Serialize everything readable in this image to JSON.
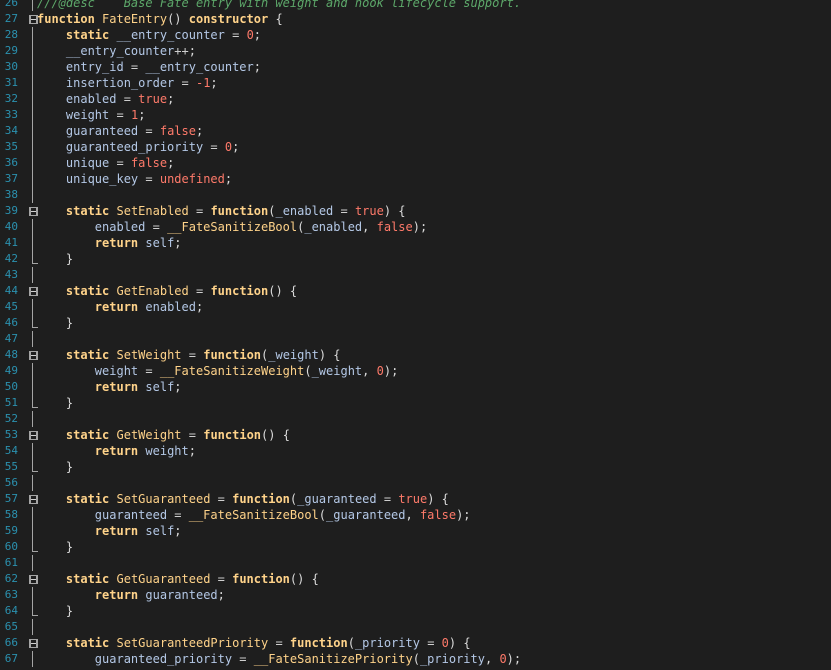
{
  "colors": {
    "background": "#1e1e1e",
    "line_number": "#2b91af",
    "keyword": "#ffd38a",
    "variable": "#b4c8e6",
    "number": "#ff7a6a",
    "comment": "#5da86a"
  },
  "lines": [
    {
      "num": "26",
      "fold": "line",
      "tokens": [
        [
          "cm",
          "///@desc    Base Fate entry with weight and hook lifecycle support."
        ]
      ]
    },
    {
      "num": "27",
      "fold": "box",
      "tokens": [
        [
          "kw",
          "function"
        ],
        [
          "pl",
          " "
        ],
        [
          "fn",
          "FateEntry"
        ],
        [
          "p",
          "() "
        ],
        [
          "kw",
          "constructor"
        ],
        [
          "p",
          " {"
        ]
      ]
    },
    {
      "num": "28",
      "fold": "line",
      "tokens": [
        [
          "pl",
          "    "
        ],
        [
          "kw",
          "static"
        ],
        [
          "pl",
          " "
        ],
        [
          "var",
          "__entry_counter"
        ],
        [
          "op",
          " = "
        ],
        [
          "num",
          "0"
        ],
        [
          "p",
          ";"
        ]
      ]
    },
    {
      "num": "29",
      "fold": "line",
      "tokens": [
        [
          "pl",
          "    "
        ],
        [
          "var",
          "__entry_counter"
        ],
        [
          "op",
          "++"
        ],
        [
          "p",
          ";"
        ]
      ]
    },
    {
      "num": "30",
      "fold": "line",
      "tokens": [
        [
          "pl",
          "    "
        ],
        [
          "var",
          "entry_id"
        ],
        [
          "op",
          " = "
        ],
        [
          "var",
          "__entry_counter"
        ],
        [
          "p",
          ";"
        ]
      ]
    },
    {
      "num": "31",
      "fold": "line",
      "tokens": [
        [
          "pl",
          "    "
        ],
        [
          "var",
          "insertion_order"
        ],
        [
          "op",
          " = "
        ],
        [
          "num",
          "-1"
        ],
        [
          "p",
          ";"
        ]
      ]
    },
    {
      "num": "32",
      "fold": "line",
      "tokens": [
        [
          "pl",
          "    "
        ],
        [
          "var",
          "enabled"
        ],
        [
          "op",
          " = "
        ],
        [
          "bool",
          "true"
        ],
        [
          "p",
          ";"
        ]
      ]
    },
    {
      "num": "33",
      "fold": "line",
      "tokens": [
        [
          "pl",
          "    "
        ],
        [
          "var",
          "weight"
        ],
        [
          "op",
          " = "
        ],
        [
          "num",
          "1"
        ],
        [
          "p",
          ";"
        ]
      ]
    },
    {
      "num": "34",
      "fold": "line",
      "tokens": [
        [
          "pl",
          "    "
        ],
        [
          "var",
          "guaranteed"
        ],
        [
          "op",
          " = "
        ],
        [
          "bool",
          "false"
        ],
        [
          "p",
          ";"
        ]
      ]
    },
    {
      "num": "35",
      "fold": "line",
      "tokens": [
        [
          "pl",
          "    "
        ],
        [
          "var",
          "guaranteed_priority"
        ],
        [
          "op",
          " = "
        ],
        [
          "num",
          "0"
        ],
        [
          "p",
          ";"
        ]
      ]
    },
    {
      "num": "36",
      "fold": "line",
      "tokens": [
        [
          "pl",
          "    "
        ],
        [
          "var",
          "unique"
        ],
        [
          "op",
          " = "
        ],
        [
          "bool",
          "false"
        ],
        [
          "p",
          ";"
        ]
      ]
    },
    {
      "num": "37",
      "fold": "line",
      "tokens": [
        [
          "pl",
          "    "
        ],
        [
          "var",
          "unique_key"
        ],
        [
          "op",
          " = "
        ],
        [
          "bool",
          "undefined"
        ],
        [
          "p",
          ";"
        ]
      ]
    },
    {
      "num": "38",
      "fold": "line",
      "tokens": []
    },
    {
      "num": "39",
      "fold": "box",
      "tokens": [
        [
          "pl",
          "    "
        ],
        [
          "kw",
          "static"
        ],
        [
          "pl",
          " "
        ],
        [
          "fn",
          "SetEnabled"
        ],
        [
          "op",
          " = "
        ],
        [
          "kw",
          "function"
        ],
        [
          "p",
          "("
        ],
        [
          "var",
          "_enabled"
        ],
        [
          "op",
          " = "
        ],
        [
          "bool",
          "true"
        ],
        [
          "p",
          ") {"
        ]
      ]
    },
    {
      "num": "40",
      "fold": "line",
      "tokens": [
        [
          "pl",
          "        "
        ],
        [
          "var",
          "enabled"
        ],
        [
          "op",
          " = "
        ],
        [
          "fn",
          "__FateSanitizeBool"
        ],
        [
          "p",
          "("
        ],
        [
          "var",
          "_enabled"
        ],
        [
          "p",
          ", "
        ],
        [
          "bool",
          "false"
        ],
        [
          "p",
          ");"
        ]
      ]
    },
    {
      "num": "41",
      "fold": "line",
      "tokens": [
        [
          "pl",
          "        "
        ],
        [
          "kw",
          "return"
        ],
        [
          "pl",
          " "
        ],
        [
          "var",
          "self"
        ],
        [
          "p",
          ";"
        ]
      ]
    },
    {
      "num": "42",
      "fold": "end",
      "tokens": [
        [
          "pl",
          "    "
        ],
        [
          "p",
          "}"
        ]
      ]
    },
    {
      "num": "43",
      "fold": "line",
      "tokens": []
    },
    {
      "num": "44",
      "fold": "box",
      "tokens": [
        [
          "pl",
          "    "
        ],
        [
          "kw",
          "static"
        ],
        [
          "pl",
          " "
        ],
        [
          "fn",
          "GetEnabled"
        ],
        [
          "op",
          " = "
        ],
        [
          "kw",
          "function"
        ],
        [
          "p",
          "() {"
        ]
      ]
    },
    {
      "num": "45",
      "fold": "line",
      "tokens": [
        [
          "pl",
          "        "
        ],
        [
          "kw",
          "return"
        ],
        [
          "pl",
          " "
        ],
        [
          "var",
          "enabled"
        ],
        [
          "p",
          ";"
        ]
      ]
    },
    {
      "num": "46",
      "fold": "end",
      "tokens": [
        [
          "pl",
          "    "
        ],
        [
          "p",
          "}"
        ]
      ]
    },
    {
      "num": "47",
      "fold": "line",
      "tokens": []
    },
    {
      "num": "48",
      "fold": "box",
      "tokens": [
        [
          "pl",
          "    "
        ],
        [
          "kw",
          "static"
        ],
        [
          "pl",
          " "
        ],
        [
          "fn",
          "SetWeight"
        ],
        [
          "op",
          " = "
        ],
        [
          "kw",
          "function"
        ],
        [
          "p",
          "("
        ],
        [
          "var",
          "_weight"
        ],
        [
          "p",
          ") {"
        ]
      ]
    },
    {
      "num": "49",
      "fold": "line",
      "tokens": [
        [
          "pl",
          "        "
        ],
        [
          "var",
          "weight"
        ],
        [
          "op",
          " = "
        ],
        [
          "fn",
          "__FateSanitizeWeight"
        ],
        [
          "p",
          "("
        ],
        [
          "var",
          "_weight"
        ],
        [
          "p",
          ", "
        ],
        [
          "num",
          "0"
        ],
        [
          "p",
          ");"
        ]
      ]
    },
    {
      "num": "50",
      "fold": "line",
      "tokens": [
        [
          "pl",
          "        "
        ],
        [
          "kw",
          "return"
        ],
        [
          "pl",
          " "
        ],
        [
          "var",
          "self"
        ],
        [
          "p",
          ";"
        ]
      ]
    },
    {
      "num": "51",
      "fold": "end",
      "tokens": [
        [
          "pl",
          "    "
        ],
        [
          "p",
          "}"
        ]
      ]
    },
    {
      "num": "52",
      "fold": "line",
      "tokens": []
    },
    {
      "num": "53",
      "fold": "box",
      "tokens": [
        [
          "pl",
          "    "
        ],
        [
          "kw",
          "static"
        ],
        [
          "pl",
          " "
        ],
        [
          "fn",
          "GetWeight"
        ],
        [
          "op",
          " = "
        ],
        [
          "kw",
          "function"
        ],
        [
          "p",
          "() {"
        ]
      ]
    },
    {
      "num": "54",
      "fold": "line",
      "tokens": [
        [
          "pl",
          "        "
        ],
        [
          "kw",
          "return"
        ],
        [
          "pl",
          " "
        ],
        [
          "var",
          "weight"
        ],
        [
          "p",
          ";"
        ]
      ]
    },
    {
      "num": "55",
      "fold": "end",
      "tokens": [
        [
          "pl",
          "    "
        ],
        [
          "p",
          "}"
        ]
      ]
    },
    {
      "num": "56",
      "fold": "line",
      "tokens": []
    },
    {
      "num": "57",
      "fold": "box",
      "tokens": [
        [
          "pl",
          "    "
        ],
        [
          "kw",
          "static"
        ],
        [
          "pl",
          " "
        ],
        [
          "fn",
          "SetGuaranteed"
        ],
        [
          "op",
          " = "
        ],
        [
          "kw",
          "function"
        ],
        [
          "p",
          "("
        ],
        [
          "var",
          "_guaranteed"
        ],
        [
          "op",
          " = "
        ],
        [
          "bool",
          "true"
        ],
        [
          "p",
          ") {"
        ]
      ]
    },
    {
      "num": "58",
      "fold": "line",
      "tokens": [
        [
          "pl",
          "        "
        ],
        [
          "var",
          "guaranteed"
        ],
        [
          "op",
          " = "
        ],
        [
          "fn",
          "__FateSanitizeBool"
        ],
        [
          "p",
          "("
        ],
        [
          "var",
          "_guaranteed"
        ],
        [
          "p",
          ", "
        ],
        [
          "bool",
          "false"
        ],
        [
          "p",
          ");"
        ]
      ]
    },
    {
      "num": "59",
      "fold": "line",
      "tokens": [
        [
          "pl",
          "        "
        ],
        [
          "kw",
          "return"
        ],
        [
          "pl",
          " "
        ],
        [
          "var",
          "self"
        ],
        [
          "p",
          ";"
        ]
      ]
    },
    {
      "num": "60",
      "fold": "end",
      "tokens": [
        [
          "pl",
          "    "
        ],
        [
          "p",
          "}"
        ]
      ]
    },
    {
      "num": "61",
      "fold": "line",
      "tokens": []
    },
    {
      "num": "62",
      "fold": "box",
      "tokens": [
        [
          "pl",
          "    "
        ],
        [
          "kw",
          "static"
        ],
        [
          "pl",
          " "
        ],
        [
          "fn",
          "GetGuaranteed"
        ],
        [
          "op",
          " = "
        ],
        [
          "kw",
          "function"
        ],
        [
          "p",
          "() {"
        ]
      ]
    },
    {
      "num": "63",
      "fold": "line",
      "tokens": [
        [
          "pl",
          "        "
        ],
        [
          "kw",
          "return"
        ],
        [
          "pl",
          " "
        ],
        [
          "var",
          "guaranteed"
        ],
        [
          "p",
          ";"
        ]
      ]
    },
    {
      "num": "64",
      "fold": "end",
      "tokens": [
        [
          "pl",
          "    "
        ],
        [
          "p",
          "}"
        ]
      ]
    },
    {
      "num": "65",
      "fold": "line",
      "tokens": []
    },
    {
      "num": "66",
      "fold": "box",
      "tokens": [
        [
          "pl",
          "    "
        ],
        [
          "kw",
          "static"
        ],
        [
          "pl",
          " "
        ],
        [
          "fn",
          "SetGuaranteedPriority"
        ],
        [
          "op",
          " = "
        ],
        [
          "kw",
          "function"
        ],
        [
          "p",
          "("
        ],
        [
          "var",
          "_priority"
        ],
        [
          "op",
          " = "
        ],
        [
          "num",
          "0"
        ],
        [
          "p",
          ") {"
        ]
      ]
    },
    {
      "num": "67",
      "fold": "line",
      "tokens": [
        [
          "pl",
          "        "
        ],
        [
          "var",
          "guaranteed_priority"
        ],
        [
          "op",
          " = "
        ],
        [
          "fn",
          "__FateSanitizePriority"
        ],
        [
          "p",
          "("
        ],
        [
          "var",
          "_priority"
        ],
        [
          "p",
          ", "
        ],
        [
          "num",
          "0"
        ],
        [
          "p",
          ");"
        ]
      ]
    }
  ]
}
